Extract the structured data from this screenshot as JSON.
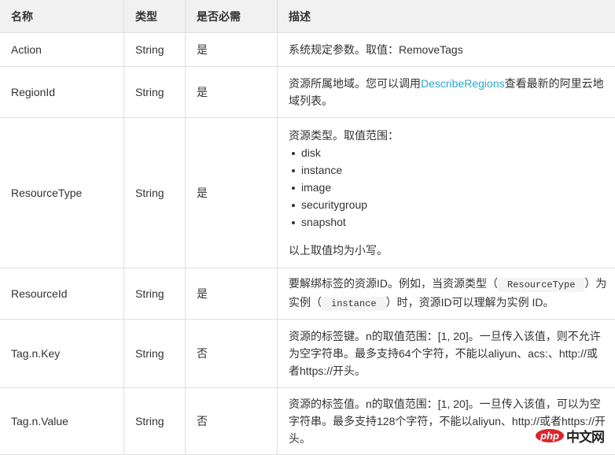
{
  "table": {
    "headers": [
      "名称",
      "类型",
      "是否必需",
      "描述"
    ],
    "rows": [
      {
        "name": "Action",
        "type": "String",
        "required": "是",
        "desc_text": "系统规定参数。取值：RemoveTags"
      },
      {
        "name": "RegionId",
        "type": "String",
        "required": "是",
        "desc_before": "资源所属地域。您可以调用",
        "desc_link": "DescribeRegions",
        "desc_after": "查看最新的阿里云地域列表。"
      },
      {
        "name": "ResourceType",
        "type": "String",
        "required": "是",
        "desc_intro": "资源类型。取值范围：",
        "desc_options": [
          "disk",
          "instance",
          "image",
          "securitygroup",
          "snapshot"
        ],
        "desc_note": "以上取值均为小写。"
      },
      {
        "name": "ResourceId",
        "type": "String",
        "required": "是",
        "desc_part1": "要解绑标签的资源ID。例如，当资源类型（",
        "desc_code1": "ResourceType",
        "desc_part2": "）为实例（",
        "desc_code2": "instance",
        "desc_part3": "）时，资源ID可以理解为实例 ID。"
      },
      {
        "name": "Tag.n.Key",
        "type": "String",
        "required": "否",
        "desc_text": "资源的标签键。n的取值范围：[1, 20]。一旦传入该值，则不允许为空字符串。最多支持64个字符，不能以aliyun、acs:、http://或者https://开头。"
      },
      {
        "name": "Tag.n.Value",
        "type": "String",
        "required": "否",
        "desc_text": "资源的标签值。n的取值范围：[1, 20]。一旦传入该值，可以为空字符串。最多支持128个字符，不能以aliyun、http://或者https://开头。"
      }
    ]
  },
  "watermark": {
    "logo": "php",
    "text": "中文网"
  },
  "colors": {
    "link": "#2ba6cb",
    "header_bg": "#f1f1f1",
    "border": "#e0e0e0",
    "watermark_red": "#d9262c"
  }
}
